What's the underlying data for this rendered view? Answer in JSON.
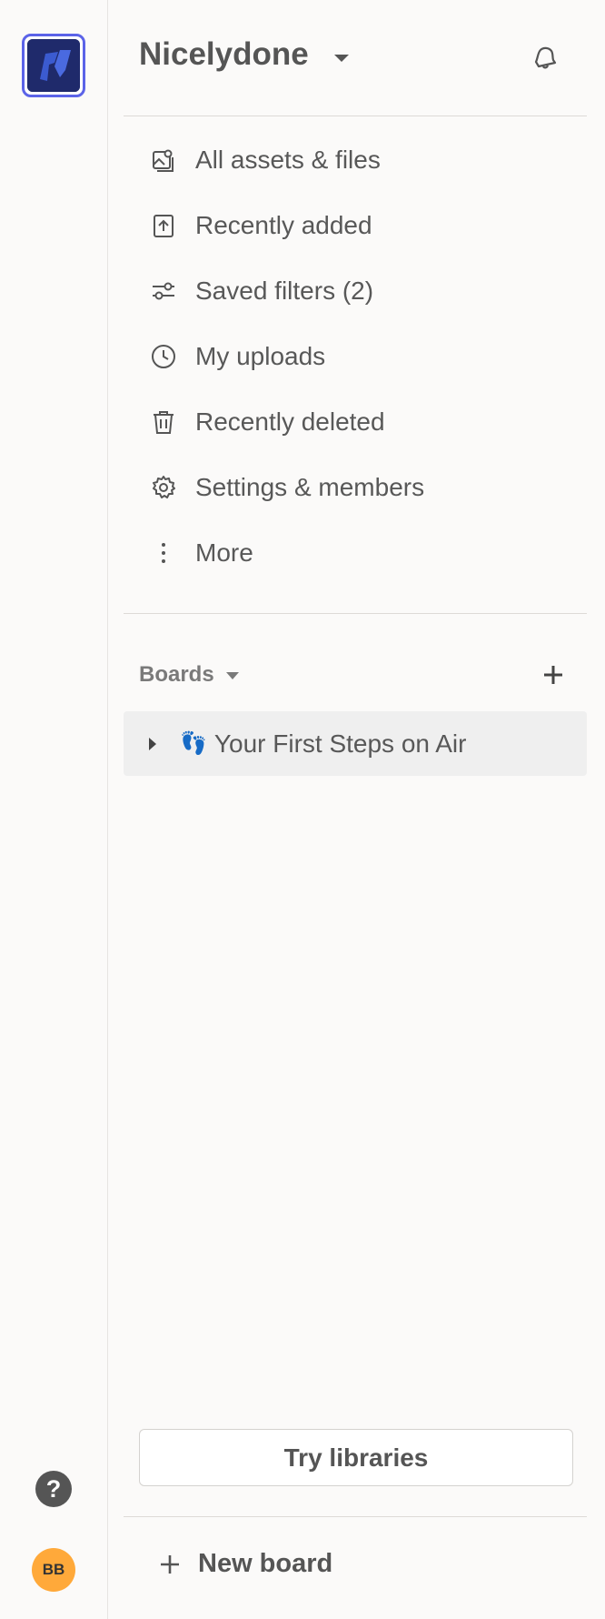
{
  "workspace": {
    "name": "Nicelydone",
    "logo_icon": "workspace-logo",
    "accent_color": "#5b63e8"
  },
  "nav": {
    "items": [
      {
        "label": "All assets & files",
        "icon": "image-stack-icon"
      },
      {
        "label": "Recently added",
        "icon": "upload-icon"
      },
      {
        "label": "Saved filters (2)",
        "icon": "sliders-icon"
      },
      {
        "label": "My uploads",
        "icon": "clock-icon"
      },
      {
        "label": "Recently deleted",
        "icon": "trash-icon"
      },
      {
        "label": "Settings & members",
        "icon": "gear-icon"
      },
      {
        "label": "More",
        "icon": "more-vertical-icon"
      }
    ]
  },
  "boards": {
    "header": "Boards",
    "items": [
      {
        "emoji": "👣",
        "label": "Your First Steps on Air"
      }
    ]
  },
  "footer": {
    "try_libraries": "Try libraries",
    "new_board": "New board"
  },
  "rail": {
    "help": "?",
    "avatar_initials": "BB",
    "avatar_color": "#ffa93a"
  }
}
